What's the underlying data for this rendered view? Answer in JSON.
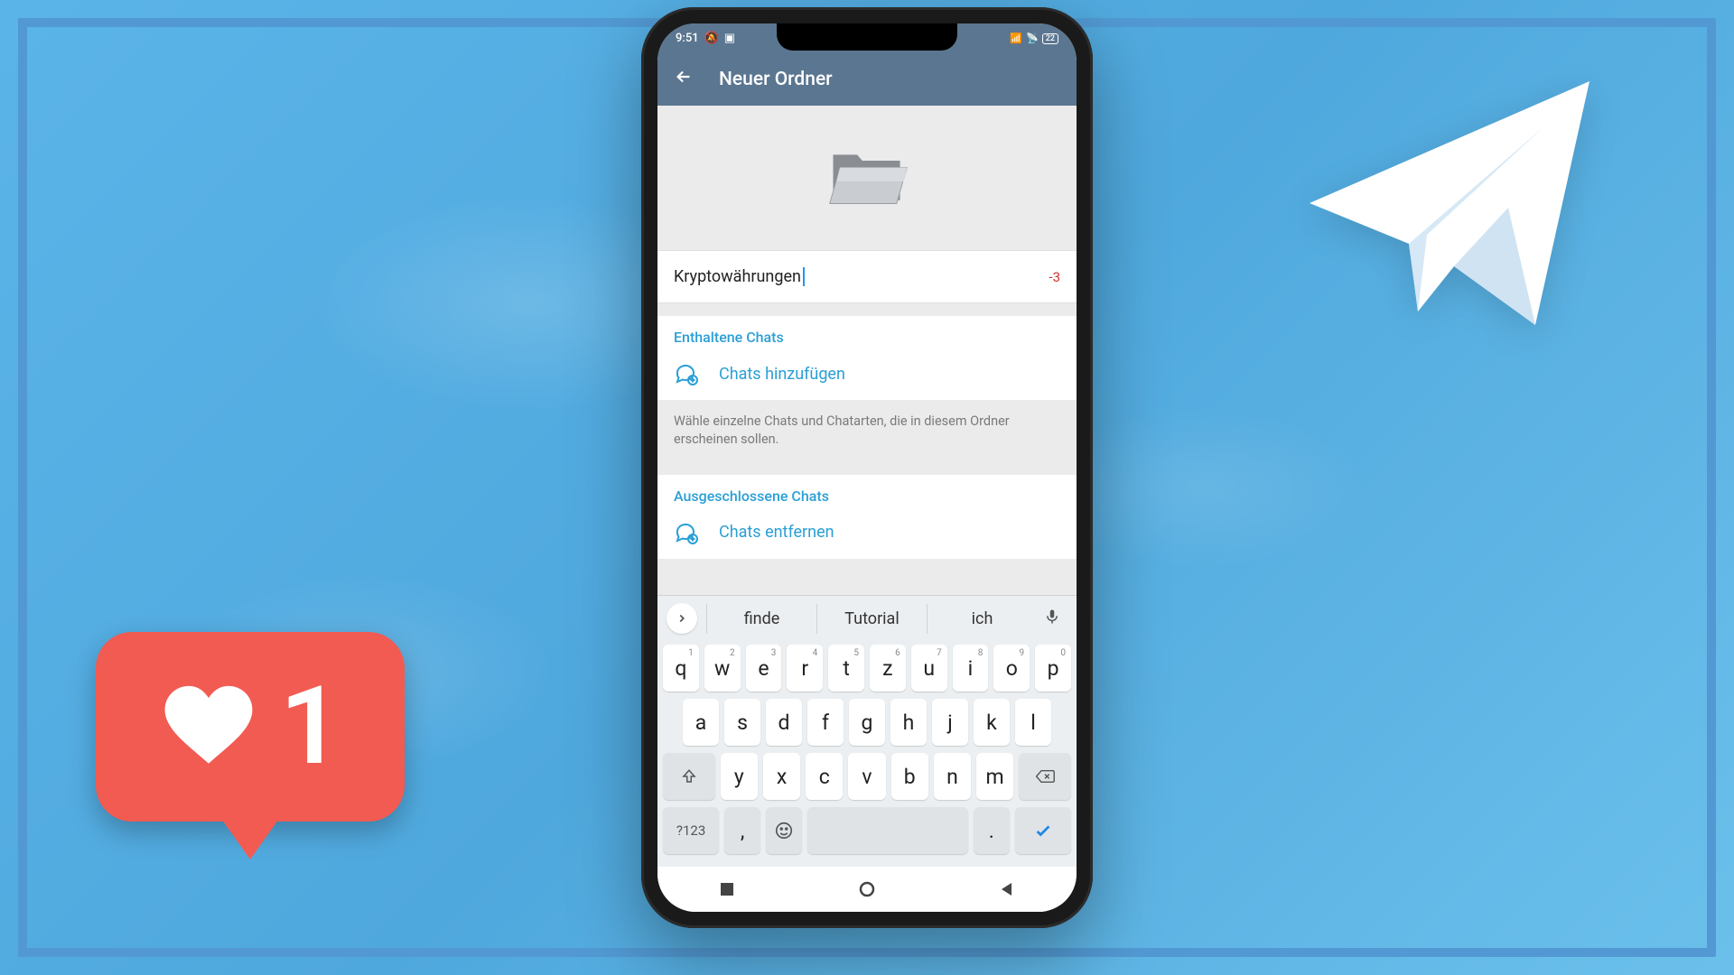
{
  "status": {
    "time": "9:51",
    "battery": "22"
  },
  "appbar": {
    "title": "Neuer Ordner"
  },
  "folder_name": {
    "value": "Kryptowährungen",
    "counter": "-3"
  },
  "included": {
    "title": "Enthaltene Chats",
    "add_label": "Chats hinzufügen",
    "helper": "Wähle einzelne Chats und Chatarten, die in diesem Ordner erscheinen sollen."
  },
  "excluded": {
    "title": "Ausgeschlossene Chats",
    "remove_label": "Chats entfernen"
  },
  "keyboard": {
    "suggestions": [
      "finde",
      "Tutorial",
      "ich"
    ],
    "row1": [
      "q",
      "w",
      "e",
      "r",
      "t",
      "z",
      "u",
      "i",
      "o",
      "p"
    ],
    "row1_nums": [
      "1",
      "2",
      "3",
      "4",
      "5",
      "6",
      "7",
      "8",
      "9",
      "0"
    ],
    "row2": [
      "a",
      "s",
      "d",
      "f",
      "g",
      "h",
      "j",
      "k",
      "l"
    ],
    "row3": [
      "y",
      "x",
      "c",
      "v",
      "b",
      "n",
      "m"
    ],
    "symbols_label": "?123",
    "comma": ",",
    "period": "."
  },
  "like": {
    "count": "1"
  }
}
